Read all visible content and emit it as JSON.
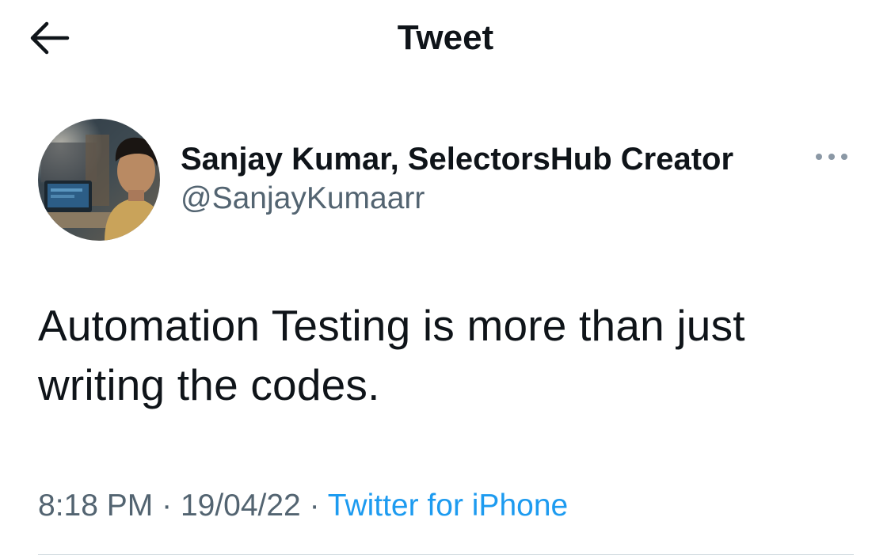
{
  "header": {
    "title": "Tweet",
    "back_icon": "arrow-left-icon"
  },
  "tweet": {
    "author": {
      "display_name": "Sanjay Kumar, SelectorsHub Creator",
      "handle": "@SanjayKumaarr"
    },
    "more_icon": "more-horizontal-icon",
    "text": "Automation Testing is more than just writing the codes.",
    "time": "8:18 PM",
    "date": "19/04/22",
    "separator": "·",
    "source": "Twitter for iPhone"
  },
  "colors": {
    "text_primary": "#0f1419",
    "text_secondary": "#536471",
    "accent": "#1d9bf0",
    "divider": "#cfd9de"
  }
}
